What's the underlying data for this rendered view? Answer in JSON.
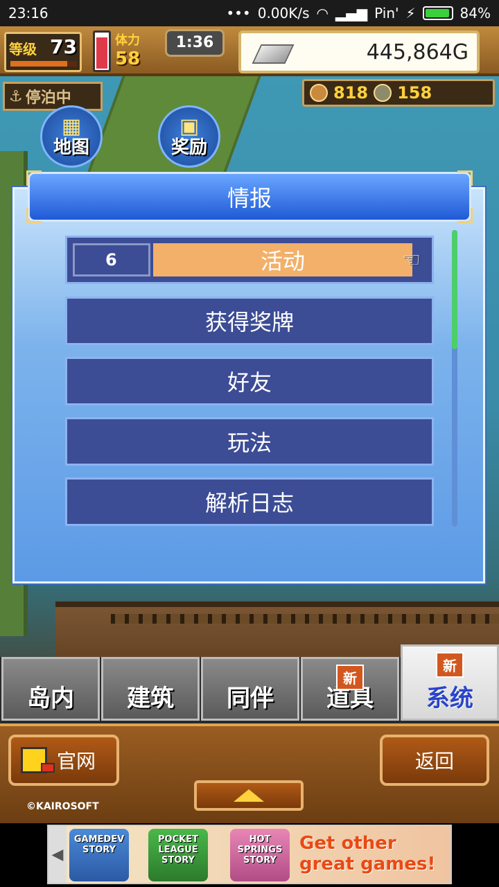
{
  "status_bar": {
    "time": "23:16",
    "speed": "0.00K/s",
    "carrier": "Pin'",
    "battery": "84%"
  },
  "hud": {
    "level_label": "等级",
    "level": "73",
    "level_progress": 0.85,
    "stamina_label": "体力",
    "stamina": "58",
    "stamina_fill": 0.9,
    "timer": "1:36",
    "money": "445,864G",
    "docked_label": "停泊中",
    "resource_a": "818",
    "resource_b": "158"
  },
  "shortcuts": {
    "map": "地图",
    "reward": "奖励"
  },
  "panel": {
    "title": "情报",
    "items": [
      {
        "label": "活动",
        "count": "6",
        "active": true
      },
      {
        "label": "获得奖牌"
      },
      {
        "label": "好友"
      },
      {
        "label": "玩法"
      },
      {
        "label": "解析日志"
      }
    ]
  },
  "tabs": [
    {
      "label": "岛内"
    },
    {
      "label": "建筑"
    },
    {
      "label": "同伴"
    },
    {
      "label": "道具",
      "badge": "新"
    },
    {
      "label": "系统",
      "badge": "新",
      "selected": true
    }
  ],
  "footer": {
    "official": "官网",
    "back": "返回",
    "copyright": "©KAIROSOFT"
  },
  "ad": {
    "games": [
      "GAMEDEV STORY",
      "POCKET LEAGUE STORY",
      "HOT SPRINGS STORY"
    ],
    "cta": "Get other great games!"
  },
  "colors": {
    "accent": "#3c4c95",
    "active_item": "#f2b06a",
    "panel": "#5c9ae6"
  }
}
